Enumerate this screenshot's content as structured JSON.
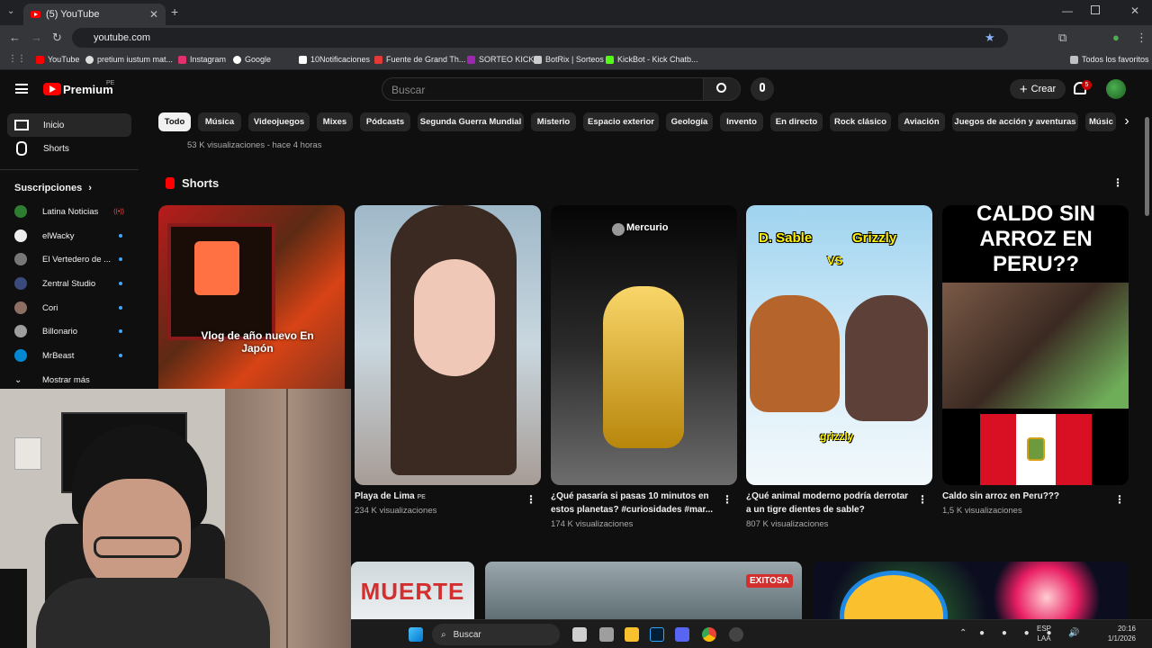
{
  "browser": {
    "tab_title": "(5) YouTube",
    "url": "youtube.com",
    "bookmarks": [
      "YouTube",
      "pretium iustum mat...",
      "Instagram",
      "Google",
      "10Notificaciones",
      "Fuente de Grand Th...",
      "SORTEO KICK",
      "BotRix | Sorteos",
      "KickBot - Kick Chatb...",
      "Todos los favoritos"
    ]
  },
  "header": {
    "logo_text": "Premium",
    "region": "PE",
    "search_placeholder": "Buscar",
    "create_label": "Crear",
    "notif_count": "5"
  },
  "sidebar": {
    "items": [
      {
        "label": "Inicio"
      },
      {
        "label": "Shorts"
      }
    ],
    "subs_title": "Suscripciones",
    "channels": [
      {
        "name": "Latina Noticias",
        "color": "#2e7d32"
      },
      {
        "name": "elWacky",
        "color": "#ffffff"
      },
      {
        "name": "El Vertedero de ...",
        "color": "#888888"
      },
      {
        "name": "Zentral Studio",
        "color": "#3a4a7a"
      },
      {
        "name": "Cori",
        "color": "#8d6e63"
      },
      {
        "name": "Billonario",
        "color": "#9e9e9e"
      },
      {
        "name": "MrBeast",
        "color": "#0288d1"
      }
    ],
    "more": "Mostrar más"
  },
  "chips": [
    "Todo",
    "Música",
    "Videojuegos",
    "Mixes",
    "Pódcasts",
    "Segunda Guerra Mundial",
    "Misterio",
    "Espacio exterior",
    "Geología",
    "Invento",
    "En directo",
    "Rock clásico",
    "Aviación",
    "Juegos de acción y aventuras",
    "Músic"
  ],
  "prev_meta": "53 K visualizaciones - hace 4 horas",
  "shorts": {
    "section_title": "Shorts",
    "items": [
      {
        "overlay": "Vlog de año nuevo En Japón",
        "title": "",
        "views": ""
      },
      {
        "title": "Playa de Lima",
        "tag": "PE",
        "views": "234 K visualizaciones"
      },
      {
        "overlay": "Mercurio",
        "title": "¿Qué pasaría si pasas 10 minutos en estos planetas? #curiosidades #mar...",
        "views": "174 K visualizaciones"
      },
      {
        "overlay": "D. Sable",
        "overlay2": "Grizzly",
        "overlay3": "VS",
        "overlay4": "grizzly",
        "title": "¿Qué animal moderno podría derrotar a un tigre dientes de sable?",
        "views": "807 K visualizaciones"
      },
      {
        "overlay": "CALDO SIN ARROZ EN PERU??",
        "title": "Caldo sin arroz en Peru???",
        "views": "1,5 K visualizaciones"
      }
    ]
  },
  "row2": {
    "thumb1_text": "MUERTE",
    "thumb2_text": "EXITOSA"
  },
  "taskbar": {
    "search": "Buscar",
    "lang1": "ESP",
    "lang2": "LAA",
    "time": "20:16",
    "date": "1/1/2026"
  }
}
